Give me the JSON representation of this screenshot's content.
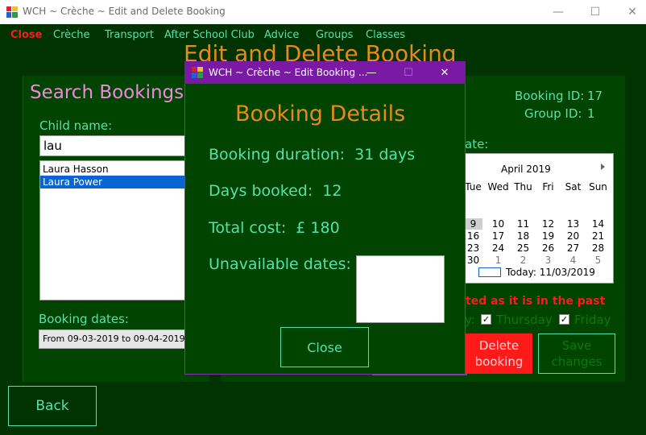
{
  "window": {
    "title": "WCH ~ Crèche ~ Edit and Delete Booking",
    "minimize": "—",
    "maximize": "☐",
    "close": "✕"
  },
  "menu": {
    "items": [
      "Close",
      "Crèche",
      "Transport",
      "After School Club",
      "Advice",
      "Groups",
      "Classes"
    ]
  },
  "page": {
    "heading": "Edit and Delete Booking"
  },
  "search": {
    "title": "Search Bookings",
    "child_label": "Child name:",
    "child_value": "lau",
    "results": [
      "Laura Hasson",
      "Laura Power"
    ],
    "selected_index": 1,
    "dates_label": "Booking dates:",
    "dates_value": "From  09-03-2019  to  09-04-2019"
  },
  "back_label": "Back",
  "booking": {
    "id_label": "Booking ID:",
    "id_value": "17",
    "group_label": "Group ID:",
    "group_value": "1",
    "date_label_partial": "ate:"
  },
  "calendar": {
    "month": "April 2019",
    "next_icon": "chevron-right-icon",
    "day_headers": [
      "Tue",
      "Wed",
      "Thu",
      "Fri",
      "Sat",
      "Sun"
    ],
    "rows": [
      [
        "9",
        "10",
        "11",
        "12",
        "13",
        "14"
      ],
      [
        "16",
        "17",
        "18",
        "19",
        "20",
        "21"
      ],
      [
        "23",
        "24",
        "25",
        "26",
        "27",
        "28"
      ],
      [
        "30",
        "1",
        "2",
        "3",
        "4",
        "5"
      ]
    ],
    "today_text": "Today: 11/03/2019"
  },
  "warning": {
    "text": "ted as it is in the past"
  },
  "days": {
    "partial_prefix": "y:",
    "thursday": "Thursday",
    "friday": "Friday",
    "check_mark": "✓"
  },
  "actions": {
    "delete_label": "Delete booking",
    "save_label": "Save changes"
  },
  "dialog": {
    "title": "WCH ~ Crèche ~ Edit Booking ...",
    "heading": "Booking Details",
    "duration_label": "Booking duration:",
    "duration_value": "31 days",
    "days_label": "Days booked:",
    "days_value": "12",
    "cost_label": "Total cost:",
    "cost_value": "£ 180",
    "unavailable_label": "Unavailable dates:",
    "close_label": "Close",
    "minimize": "—",
    "maximize": "☐",
    "close_icon": "✕"
  },
  "colors": {
    "background": "#003300",
    "panel": "#004400",
    "accent_teal": "#55e0b0",
    "accent_orange": "#e88a1a",
    "search_pink": "#ee88dd",
    "danger_red": "#ff1a1a",
    "dialog_title": "#7a1aa4"
  }
}
